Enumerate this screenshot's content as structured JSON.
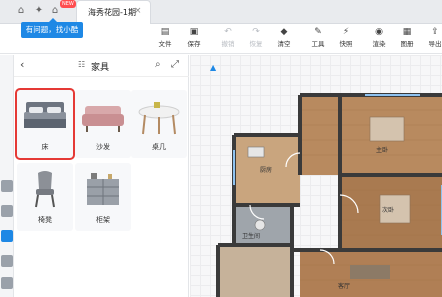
{
  "tabs": {
    "new_badge": "NEW",
    "document_tab": "海秀花园-1期",
    "close_icon": "×"
  },
  "tooltip": {
    "text": "有问题，找小酷"
  },
  "toolbar": {
    "items": [
      {
        "label": "文件",
        "icon": "file-icon",
        "disabled": false
      },
      {
        "label": "保存",
        "icon": "save-icon",
        "disabled": false
      },
      {
        "label": "撤销",
        "icon": "undo-icon",
        "disabled": true
      },
      {
        "label": "恢复",
        "icon": "redo-icon",
        "disabled": true
      },
      {
        "label": "清空",
        "icon": "eraser-icon",
        "disabled": false
      },
      {
        "label": "工具",
        "icon": "tool-icon",
        "disabled": false
      },
      {
        "label": "快照",
        "icon": "snapshot-icon",
        "disabled": false
      },
      {
        "label": "渲染",
        "icon": "render-icon",
        "disabled": false
      },
      {
        "label": "图册",
        "icon": "album-icon",
        "disabled": false
      },
      {
        "label": "导出",
        "icon": "export-icon",
        "disabled": false
      }
    ]
  },
  "panel": {
    "title": "家具",
    "items": [
      {
        "name": "床",
        "selected": true
      },
      {
        "name": "沙发",
        "selected": false
      },
      {
        "name": "桌几",
        "selected": false
      },
      {
        "name": "椅凳",
        "selected": false
      },
      {
        "name": "柜架",
        "selected": false
      }
    ]
  },
  "floorplan": {
    "rooms": [
      "主卧",
      "客厅",
      "次卧",
      "厨房",
      "卫生间"
    ]
  },
  "colors": {
    "accent": "#1e88e5",
    "selection": "#e53935",
    "wall": "#3a3a3a",
    "floor_wood": "#b88a5f"
  }
}
